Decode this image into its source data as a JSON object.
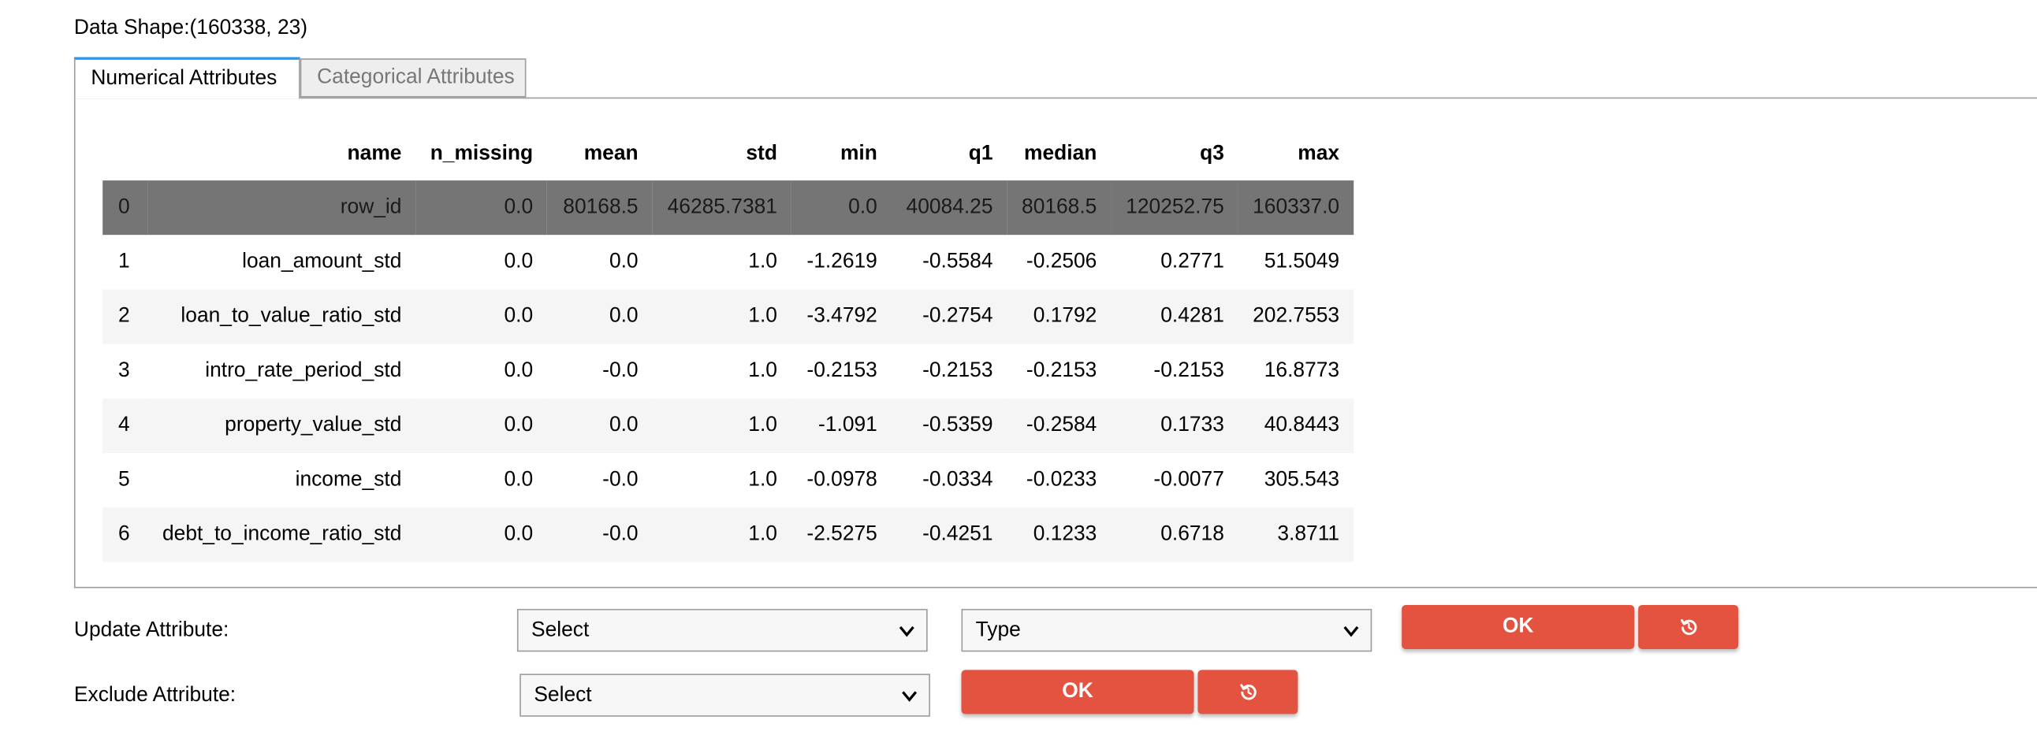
{
  "data_shape": "Data Shape:(160338, 23)",
  "tabs": [
    {
      "label": "Numerical Attributes",
      "active": true
    },
    {
      "label": "Categorical Attributes",
      "active": false
    }
  ],
  "table": {
    "columns": [
      "",
      "name",
      "n_missing",
      "mean",
      "std",
      "min",
      "q1",
      "median",
      "q3",
      "max"
    ],
    "rows": [
      [
        "0",
        "row_id",
        "0.0",
        "80168.5",
        "46285.7381",
        "0.0",
        "40084.25",
        "80168.5",
        "120252.75",
        "160337.0"
      ],
      [
        "1",
        "loan_amount_std",
        "0.0",
        "0.0",
        "1.0",
        "-1.2619",
        "-0.5584",
        "-0.2506",
        "0.2771",
        "51.5049"
      ],
      [
        "2",
        "loan_to_value_ratio_std",
        "0.0",
        "0.0",
        "1.0",
        "-3.4792",
        "-0.2754",
        "0.1792",
        "0.4281",
        "202.7553"
      ],
      [
        "3",
        "intro_rate_period_std",
        "0.0",
        "-0.0",
        "1.0",
        "-0.2153",
        "-0.2153",
        "-0.2153",
        "-0.2153",
        "16.8773"
      ],
      [
        "4",
        "property_value_std",
        "0.0",
        "0.0",
        "1.0",
        "-1.091",
        "-0.5359",
        "-0.2584",
        "0.1733",
        "40.8443"
      ],
      [
        "5",
        "income_std",
        "0.0",
        "-0.0",
        "1.0",
        "-0.0978",
        "-0.0334",
        "-0.0233",
        "-0.0077",
        "305.543"
      ],
      [
        "6",
        "debt_to_income_ratio_std",
        "0.0",
        "-0.0",
        "1.0",
        "-2.5275",
        "-0.4251",
        "0.1233",
        "0.6718",
        "3.8711"
      ]
    ],
    "selected_row": 0
  },
  "update_attribute": {
    "label": "Update Attribute:",
    "select_value": "Select",
    "type_value": "Type",
    "ok_label": "OK",
    "reset_icon": "reset-icon"
  },
  "exclude_attribute": {
    "label": "Exclude Attribute:",
    "select_value": "Select",
    "ok_label": "OK",
    "reset_icon": "reset-icon"
  },
  "colors": {
    "accent_button": "#e45240",
    "selected_row": "#757575",
    "tab_active_border": "#2196f3"
  }
}
